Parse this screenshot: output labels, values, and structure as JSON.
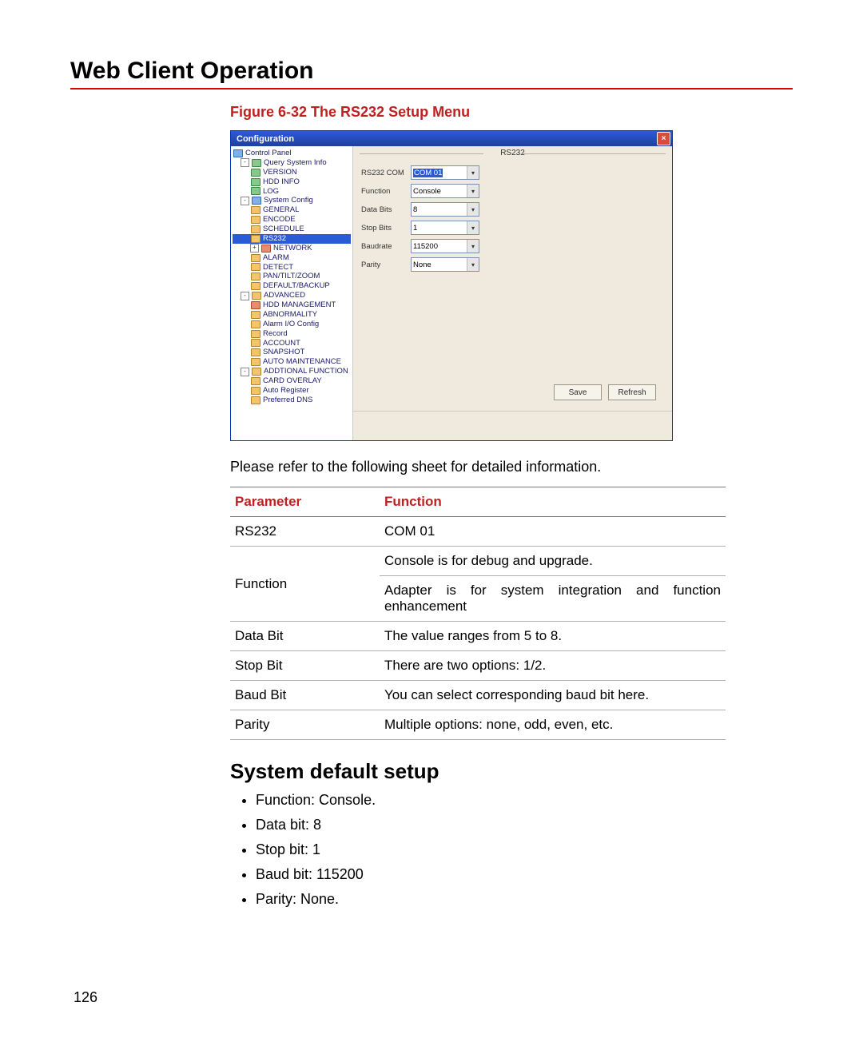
{
  "title": "Web Client Operation",
  "caption": "Figure 6-32 The RS232 Setup Menu",
  "window": {
    "title": "Configuration",
    "close_symbol": "×",
    "group_title": "RS232",
    "tree": {
      "root": "Control Panel",
      "query": "Query System Info",
      "query_children": [
        "VERSION",
        "HDD INFO",
        "LOG"
      ],
      "sysconfig": "System Config",
      "sys_children": [
        "GENERAL",
        "ENCODE",
        "SCHEDULE",
        "RS232",
        "NETWORK",
        "ALARM",
        "DETECT",
        "PAN/TILT/ZOOM",
        "DEFAULT/BACKUP"
      ],
      "advanced": "ADVANCED",
      "adv_children": [
        "HDD MANAGEMENT",
        "ABNORMALITY",
        "Alarm I/O Config",
        "Record",
        "ACCOUNT",
        "SNAPSHOT",
        "AUTO MAINTENANCE"
      ],
      "addfunc": "ADDTIONAL FUNCTION",
      "add_children": [
        "CARD OVERLAY",
        "Auto Register",
        "Preferred DNS"
      ]
    },
    "fields": [
      {
        "label": "RS232 COM",
        "value": "COM 01",
        "highlight": true
      },
      {
        "label": "Function",
        "value": "Console"
      },
      {
        "label": "Data Bits",
        "value": "8"
      },
      {
        "label": "Stop Bits",
        "value": "1"
      },
      {
        "label": "Baudrate",
        "value": "115200"
      },
      {
        "label": "Parity",
        "value": "None"
      }
    ],
    "buttons": {
      "save": "Save",
      "refresh": "Refresh"
    }
  },
  "body_text": "Please refer to the following sheet for detailed information.",
  "table": {
    "headers": [
      "Parameter",
      "Function"
    ],
    "rows": [
      {
        "param": "RS232",
        "func": "COM 01"
      },
      {
        "param": "Function",
        "func1": "Console is for debug and upgrade.",
        "func2": "Adapter is for system integration and function enhancement"
      },
      {
        "param": "Data Bit",
        "func": "The value ranges from 5 to 8."
      },
      {
        "param": "Stop Bit",
        "func": "There are two options: 1/2."
      },
      {
        "param": "Baud Bit",
        "func": "You can select corresponding baud bit here."
      },
      {
        "param": "Parity",
        "func": "Multiple options: none, odd, even, etc."
      }
    ]
  },
  "defaults_heading": "System default setup",
  "defaults": [
    "Function: Console.",
    "Data bit: 8",
    "Stop bit: 1",
    "Baud bit: 115200",
    "Parity: None."
  ],
  "page_number": "126"
}
